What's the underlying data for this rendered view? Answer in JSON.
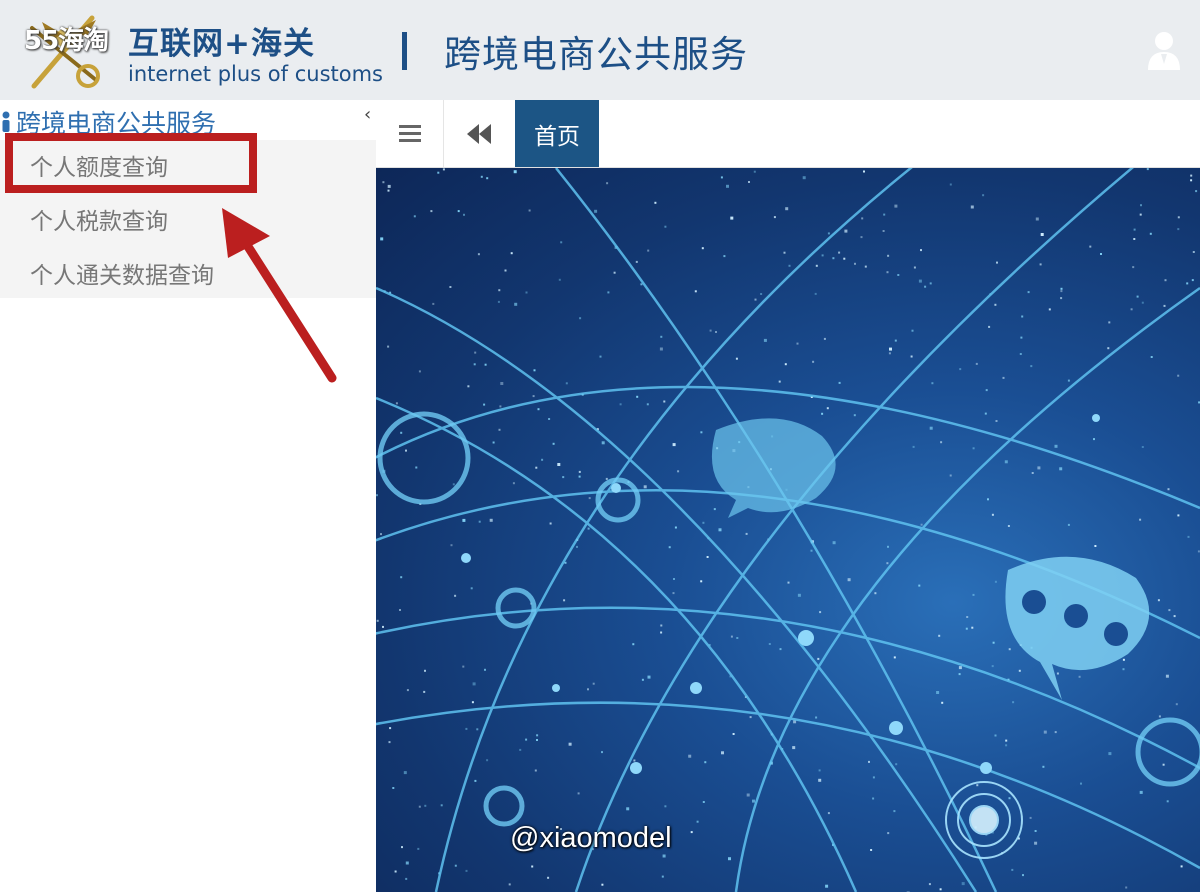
{
  "watermarks": {
    "top": "55海淘",
    "bottom": "@xiaomodel"
  },
  "header": {
    "logo_title": "互联网+海关",
    "logo_subtitle": "internet plus of customs",
    "separator": "|",
    "page_title": "跨境电商公共服务"
  },
  "sidebar": {
    "group_title": "跨境电商公共服务",
    "collapse_glyph": "‹",
    "items": [
      {
        "label": "个人额度查询",
        "highlighted": true
      },
      {
        "label": "个人税款查询",
        "highlighted": false
      },
      {
        "label": "个人通关数据查询",
        "highlighted": false
      }
    ]
  },
  "tabs": {
    "menu_icon": "≡",
    "prev_icon": "◀◀",
    "home_label": "首页"
  },
  "colors": {
    "brand": "#1d4f86",
    "active_tab": "#1c5585",
    "highlight": "#bb1f1f",
    "header_bg": "#eaedf0"
  }
}
